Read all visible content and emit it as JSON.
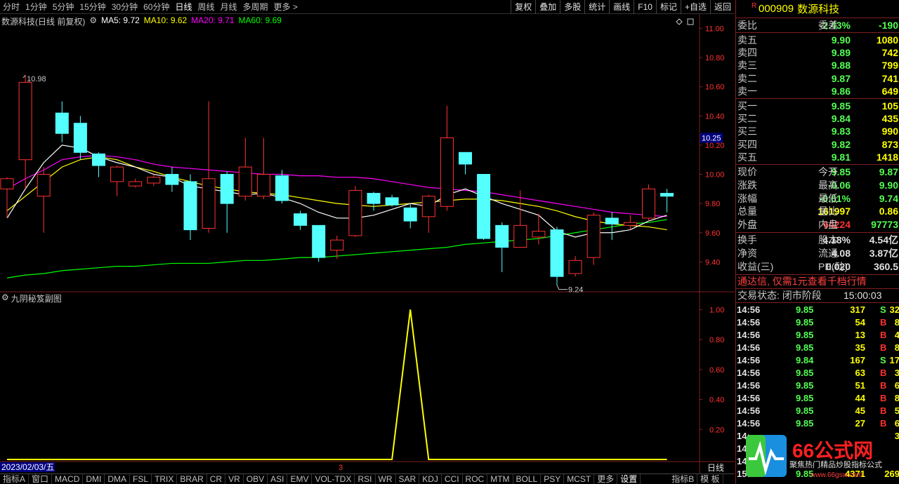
{
  "toolbar": {
    "periods": [
      "分时",
      "1分钟",
      "5分钟",
      "15分钟",
      "30分钟",
      "60分钟",
      "日线",
      "周线",
      "月线",
      "多周期",
      "更多 >"
    ],
    "active_period": "日线",
    "tools": [
      "复权",
      "叠加",
      "多股",
      "统计",
      "画线",
      "F10",
      "标记",
      "+自选",
      "返回"
    ]
  },
  "legend": {
    "title": "数源科技(日线 前复权)",
    "ma5": "MA5: 9.72",
    "ma10": "MA10: 9.62",
    "ma20": "MA20: 9.71",
    "ma60": "MA60: 9.69"
  },
  "colors": {
    "up": "#ff3232",
    "down": "#54ffff",
    "ma5": "#ffffff",
    "ma10": "#ffff00",
    "ma20": "#ff00ff",
    "ma60": "#00ff00",
    "grid": "#802020",
    "axis_text": "#ff3232",
    "sub_line": "#ffff00"
  },
  "chart_data": {
    "type": "candlestick",
    "ylim": [
      9.2,
      11.05
    ],
    "yticks": [
      "11.00",
      "10.80",
      "10.60",
      "10.40",
      "10.20",
      "10.00",
      "9.80",
      "9.60",
      "9.40"
    ],
    "current_price_label": "10.25",
    "high_marker": "10.98",
    "low_marker": "9.24",
    "candles": [
      [
        9.9,
        9.97,
        9.7,
        9.98
      ],
      [
        10.1,
        10.63,
        9.9,
        10.68
      ],
      [
        9.85,
        10.0,
        9.6,
        10.05
      ],
      [
        10.42,
        10.28,
        10.22,
        10.5
      ],
      [
        10.35,
        10.15,
        10.1,
        10.4
      ],
      [
        10.14,
        10.06,
        9.98,
        10.15
      ],
      [
        9.95,
        10.05,
        9.85,
        10.06
      ],
      [
        9.92,
        9.95,
        9.91,
        9.97
      ],
      [
        9.94,
        9.98,
        9.92,
        10.01
      ],
      [
        10.0,
        9.93,
        9.88,
        10.05
      ],
      [
        9.95,
        9.62,
        9.55,
        10.0
      ],
      [
        9.63,
        9.97,
        9.6,
        10.5
      ],
      [
        10.0,
        9.8,
        9.6,
        10.02
      ],
      [
        9.85,
        10.05,
        9.82,
        10.25
      ],
      [
        9.85,
        10.0,
        9.83,
        10.25
      ],
      [
        9.99,
        9.82,
        9.8,
        10.03
      ],
      [
        9.73,
        9.65,
        9.62,
        9.75
      ],
      [
        9.65,
        9.43,
        9.4,
        9.65
      ],
      [
        9.48,
        9.55,
        9.42,
        9.58
      ],
      [
        9.58,
        9.89,
        9.57,
        9.92
      ],
      [
        9.87,
        9.8,
        9.75,
        9.88
      ],
      [
        9.84,
        9.79,
        9.78,
        9.86
      ],
      [
        9.77,
        9.68,
        9.63,
        9.8
      ],
      [
        9.71,
        9.85,
        9.6,
        9.86
      ],
      [
        9.78,
        10.25,
        9.75,
        10.47
      ],
      [
        10.15,
        10.07,
        10.0,
        10.15
      ],
      [
        10.0,
        9.56,
        9.55,
        10.0
      ],
      [
        9.65,
        9.5,
        9.33,
        9.67
      ],
      [
        9.5,
        9.65,
        9.5,
        9.89
      ],
      [
        9.57,
        9.61,
        9.52,
        9.73
      ],
      [
        9.62,
        9.3,
        9.24,
        9.64
      ],
      [
        9.32,
        9.41,
        9.3,
        9.44
      ],
      [
        9.43,
        9.72,
        9.38,
        9.74
      ],
      [
        9.7,
        9.66,
        9.55,
        9.74
      ],
      [
        9.65,
        9.67,
        9.62,
        9.72
      ],
      [
        9.7,
        9.9,
        9.68,
        9.93
      ],
      [
        9.87,
        9.85,
        9.74,
        9.9
      ]
    ],
    "ma5": [
      9.7,
      9.9,
      10.08,
      10.2,
      10.18,
      10.12,
      10.08,
      10.05,
      10.0,
      9.98,
      9.92,
      9.9,
      9.88,
      9.86,
      9.87,
      9.84,
      9.8,
      9.74,
      9.7,
      9.7,
      9.72,
      9.76,
      9.8,
      9.78,
      9.86,
      9.9,
      9.85,
      9.8,
      9.76,
      9.72,
      9.61,
      9.57,
      9.6,
      9.6,
      9.62,
      9.68,
      9.72
    ],
    "ma10": [
      9.75,
      9.85,
      9.95,
      10.05,
      10.1,
      10.12,
      10.1,
      10.05,
      10.02,
      9.98,
      9.95,
      9.92,
      9.9,
      9.88,
      9.87,
      9.86,
      9.84,
      9.82,
      9.8,
      9.79,
      9.78,
      9.79,
      9.8,
      9.81,
      9.82,
      9.83,
      9.83,
      9.82,
      9.8,
      9.78,
      9.75,
      9.71,
      9.68,
      9.66,
      9.65,
      9.64,
      9.62
    ],
    "ma20": [
      9.9,
      9.97,
      10.03,
      10.1,
      10.12,
      10.13,
      10.12,
      10.1,
      10.07,
      10.05,
      10.04,
      10.03,
      10.02,
      10.01,
      10.0,
      10.0,
      9.99,
      9.99,
      9.98,
      9.98,
      9.97,
      9.95,
      9.93,
      9.91,
      9.9,
      9.89,
      9.88,
      9.86,
      9.84,
      9.82,
      9.8,
      9.78,
      9.76,
      9.74,
      9.73,
      9.72,
      9.71
    ],
    "ma60": [
      9.29,
      9.31,
      9.32,
      9.34,
      9.35,
      9.36,
      9.37,
      9.37,
      9.38,
      9.39,
      9.39,
      9.39,
      9.4,
      9.41,
      9.41,
      9.42,
      9.43,
      9.43,
      9.44,
      9.45,
      9.46,
      9.47,
      9.48,
      9.49,
      9.5,
      9.52,
      9.53,
      9.54,
      9.55,
      9.56,
      9.58,
      9.6,
      9.62,
      9.64,
      9.66,
      9.67,
      9.69
    ],
    "indicator": {
      "title": "九阴秘笈副图",
      "ylim": [
        0,
        1.1
      ],
      "yticks": [
        "1.00",
        "0.80",
        "0.60",
        "0.40",
        "0.20"
      ],
      "values": [
        0,
        0,
        0,
        0,
        0,
        0,
        0,
        0,
        0,
        0,
        0,
        0,
        0,
        0,
        0,
        0,
        0,
        0,
        0,
        0,
        0,
        0,
        1,
        0,
        0,
        0,
        0,
        0,
        0,
        0,
        0,
        0,
        0,
        0,
        0,
        0,
        0
      ]
    },
    "date_label": "2023/02/03/五",
    "scroll_mark": "3",
    "period_label": "日线"
  },
  "bottom_tabs": [
    "指标A",
    "窗口",
    "MACD",
    "DMI",
    "DMA",
    "FSL",
    "TRIX",
    "BRAR",
    "CR",
    "VR",
    "OBV",
    "ASI",
    "EMV",
    "VOL-TDX",
    "RSI",
    "WR",
    "SAR",
    "KDJ",
    "CCI",
    "ROC",
    "MTM",
    "BOLL",
    "PSY",
    "MCST",
    "更多",
    "设置",
    "指标B",
    "模 板"
  ],
  "stock": {
    "badge": "R",
    "code": "000909",
    "name": "数源科技"
  },
  "quote": {
    "weibi": {
      "label": "委比",
      "value": "-2.43%",
      "label2": "委差",
      "value2": "-190"
    },
    "sells": [
      {
        "label": "卖五",
        "price": "9.90",
        "vol": "1080"
      },
      {
        "label": "卖四",
        "price": "9.89",
        "vol": "742"
      },
      {
        "label": "卖三",
        "price": "9.88",
        "vol": "799"
      },
      {
        "label": "卖二",
        "price": "9.87",
        "vol": "741"
      },
      {
        "label": "卖一",
        "price": "9.86",
        "vol": "649"
      }
    ],
    "buys": [
      {
        "label": "买一",
        "price": "9.85",
        "vol": "105"
      },
      {
        "label": "买二",
        "price": "9.84",
        "vol": "435"
      },
      {
        "label": "买三",
        "price": "9.83",
        "vol": "990"
      },
      {
        "label": "买四",
        "price": "9.82",
        "vol": "873"
      },
      {
        "label": "买五",
        "price": "9.81",
        "vol": "1418"
      }
    ],
    "stats": [
      {
        "l1": "现价",
        "v1": "9.85",
        "c1": "#54ff54",
        "l2": "今开",
        "v2": "9.87",
        "c2": "#54ff54"
      },
      {
        "l1": "涨跌",
        "v1": "-0.06",
        "c1": "#54ff54",
        "l2": "最高",
        "v2": "9.90",
        "c2": "#54ff54"
      },
      {
        "l1": "涨幅",
        "v1": "-0.61%",
        "c1": "#54ff54",
        "l2": "最低",
        "v2": "9.74",
        "c2": "#54ff54"
      },
      {
        "l1": "总量",
        "v1": "161997",
        "c1": "#ffff00",
        "l2": "量比",
        "v2": "0.86",
        "c2": "#ffff00"
      },
      {
        "l1": "外盘",
        "v1": "64224",
        "c1": "#ff3232",
        "l2": "内盘",
        "v2": "97773",
        "c2": "#54ff54"
      }
    ],
    "finance": [
      {
        "l1": "换手",
        "v1": "4.18%",
        "l2": "股本",
        "v2": "4.54亿"
      },
      {
        "l1": "净资",
        "v1": "4.08",
        "l2": "流通",
        "v2": "3.87亿"
      },
      {
        "l1": "收益(三)",
        "v1": "0.020",
        "l2": "PE(动)",
        "v2": "360.5"
      }
    ],
    "ad": "通达信, 仅需1元查看千档行情",
    "status_label": "交易状态: 闭市阶段",
    "status_time": "15:00:03"
  },
  "ticks": [
    {
      "t": "14:56",
      "p": "9.85",
      "c": "#54ff54",
      "q": "317",
      "bs": "S",
      "n": "32"
    },
    {
      "t": "14:56",
      "p": "9.85",
      "c": "#54ff54",
      "q": "54",
      "bs": "B",
      "n": "8"
    },
    {
      "t": "14:56",
      "p": "9.85",
      "c": "#54ff54",
      "q": "13",
      "bs": "B",
      "n": "4"
    },
    {
      "t": "14:56",
      "p": "9.85",
      "c": "#54ff54",
      "q": "35",
      "bs": "B",
      "n": "8"
    },
    {
      "t": "14:56",
      "p": "9.84",
      "c": "#54ff54",
      "q": "167",
      "bs": "S",
      "n": "17"
    },
    {
      "t": "14:56",
      "p": "9.85",
      "c": "#54ff54",
      "q": "63",
      "bs": "B",
      "n": "3"
    },
    {
      "t": "14:56",
      "p": "9.85",
      "c": "#54ff54",
      "q": "51",
      "bs": "B",
      "n": "6"
    },
    {
      "t": "14:56",
      "p": "9.85",
      "c": "#54ff54",
      "q": "44",
      "bs": "B",
      "n": "8"
    },
    {
      "t": "14:56",
      "p": "9.85",
      "c": "#54ff54",
      "q": "45",
      "bs": "B",
      "n": "5"
    },
    {
      "t": "14:56",
      "p": "9.85",
      "c": "#54ff54",
      "q": "27",
      "bs": "B",
      "n": "6"
    },
    {
      "t": "14:",
      "p": "",
      "c": "#54ff54",
      "q": "",
      "bs": "",
      "n": "3"
    },
    {
      "t": "14:",
      "p": "",
      "c": "#54ff54",
      "q": "",
      "bs": "",
      "n": ""
    },
    {
      "t": "14:5",
      "p": "",
      "c": "#54ff54",
      "q": "",
      "bs": "",
      "n": ""
    },
    {
      "t": "15:00",
      "p": "9.85",
      "c": "#54ff54",
      "q": "4371",
      "bs": "",
      "n": "269"
    }
  ],
  "watermark": {
    "logo_text": "66公式网",
    "sub_text": "聚焦热门精品炒股指标公式",
    "url": "www.66gsw.com"
  }
}
